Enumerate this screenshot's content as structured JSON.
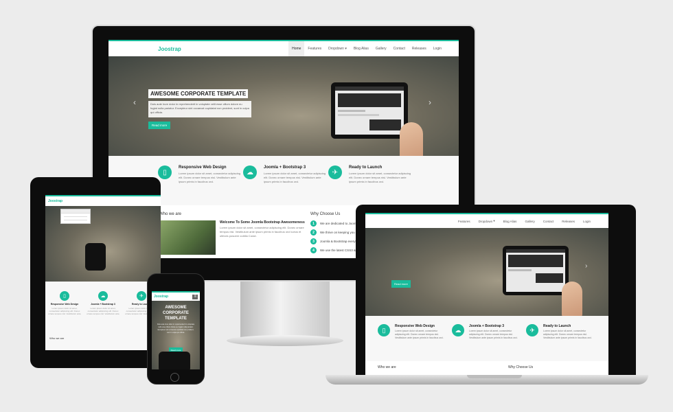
{
  "site": {
    "logo": "Joostrap",
    "nav": [
      "Home",
      "Features",
      "Dropdown",
      "Blog Alias",
      "Gallery",
      "Contact",
      "Releases",
      "Login"
    ],
    "dropdown_caret": "▾"
  },
  "hero": {
    "title": "AWESOME CORPORATE TEMPLATE",
    "description": "Duis aute irure dolor in reprehenderit in voluptate velit esse cillum dolore eu fugiat nulla pariatur. Excepteur sint occaecat cupidatat non proident, sunt in culpa qui officia.",
    "button": "Read more",
    "prev_arrow": "‹",
    "next_arrow": "›"
  },
  "features": [
    {
      "title": "Responsive Web Design",
      "text": "Lorem ipsum dolor sit amet, consectetur adipiscing elit. Donec ornare tempus nisl. Vestibulum ante ipsum primis in faucibus orci.",
      "icon": "phone-icon",
      "glyph": "▯"
    },
    {
      "title": "Joomla + Bootstrap 3",
      "text": "Lorem ipsum dolor sit amet, consectetur adipiscing elit. Donec ornare tempus nisl. Vestibulum ante ipsum primis in faucibus orci.",
      "icon": "cloud-upload-icon",
      "glyph": "☁"
    },
    {
      "title": "Ready to Launch",
      "text": "Lorem ipsum dolor sit amet, consectetur adipiscing elit. Donec ornare tempus nisl. Vestibulum ante ipsum primis in faucibus orci.",
      "icon": "plane-icon",
      "glyph": "✈"
    }
  ],
  "who": {
    "heading": "Who we are",
    "article_title": "Welcome To Some Joomla Bootstrap Awesomeness",
    "article_text": "Lorem ipsum dolor sit amet, consectetur adipiscing elit. Donec ornare tempus nisl. Vestibulum ante ipsum primis in faucibus orci luctus et ultrices posuere cubilia Curae."
  },
  "why": {
    "heading": "Why Choose Us",
    "items": [
      {
        "n": "1",
        "text": "We are dedicated to Joomla & Bootstrap"
      },
      {
        "n": "2",
        "text": "We thrive on keeping you up-to-date & informed"
      },
      {
        "n": "3",
        "text": "Joomla & Bootstrap everything in this world"
      },
      {
        "n": "4",
        "text": "We use the latest CSS3 & HTML5 technologies"
      }
    ]
  },
  "phone": {
    "menu_icon": "≡"
  },
  "colors": {
    "accent": "#1abc9c",
    "background": "#ececec",
    "bezel": "#0d0d0d",
    "aluminum": "#d4d4d4"
  }
}
